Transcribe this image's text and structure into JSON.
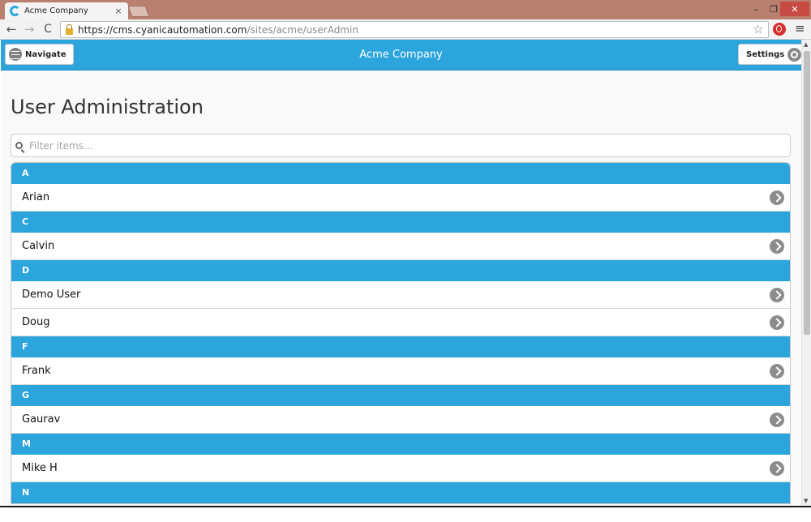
{
  "browser": {
    "tab_title": "Acme Company",
    "tab_close": "×",
    "window_min": "–",
    "window_max": "❐",
    "window_close": "✕",
    "url_host": "https://cms.cyanicautomation.com",
    "url_path": "/sites/acme/userAdmin",
    "back": "←",
    "forward": "→",
    "reload": "C",
    "star": "☆",
    "menu": "≡"
  },
  "header": {
    "navigate_label": "Navigate",
    "title": "Acme Company",
    "settings_label": "Settings"
  },
  "main": {
    "page_title": "User Administration",
    "filter_placeholder": "Filter items...",
    "groups": [
      {
        "letter": "A",
        "items": [
          "Arian"
        ]
      },
      {
        "letter": "C",
        "items": [
          "Calvin"
        ]
      },
      {
        "letter": "D",
        "items": [
          "Demo User",
          "Doug"
        ]
      },
      {
        "letter": "F",
        "items": [
          "Frank"
        ]
      },
      {
        "letter": "G",
        "items": [
          "Gaurav"
        ]
      },
      {
        "letter": "M",
        "items": [
          "Mike H"
        ]
      },
      {
        "letter": "N",
        "items": []
      }
    ]
  },
  "colors": {
    "accent": "#2ca5dc",
    "titlebar": "#b98070"
  }
}
